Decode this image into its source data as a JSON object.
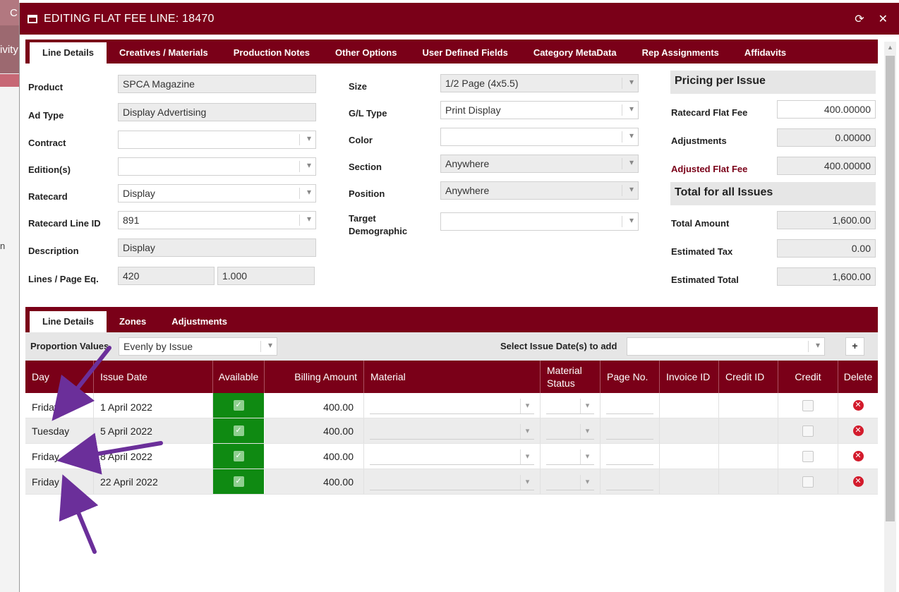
{
  "background": {
    "tab1": "C",
    "tab2": "ivity",
    "margin_char": "n"
  },
  "dialog": {
    "title": "EDITING FLAT FEE LINE: 18470",
    "refresh_icon": "refresh-icon",
    "close_icon": "close-icon",
    "accent_color": "#7a0018"
  },
  "tabs": [
    "Line Details",
    "Creatives / Materials",
    "Production Notes",
    "Other Options",
    "User Defined Fields",
    "Category MetaData",
    "Rep Assignments",
    "Affidavits"
  ],
  "form": {
    "product": {
      "label": "Product",
      "value": "SPCA Magazine"
    },
    "ad_type": {
      "label": "Ad Type",
      "value": "Display Advertising"
    },
    "contract": {
      "label": "Contract",
      "value": ""
    },
    "editions": {
      "label": "Edition(s)",
      "value": ""
    },
    "ratecard": {
      "label": "Ratecard",
      "value": "Display"
    },
    "ratecard_line_id": {
      "label": "Ratecard Line ID",
      "value": "891"
    },
    "description": {
      "label": "Description",
      "value": "Display"
    },
    "lines_page_eq": {
      "label": "Lines / Page Eq.",
      "lines": "420",
      "page_eq": "1.000"
    },
    "size": {
      "label": "Size",
      "value": "1/2 Page (4x5.5)"
    },
    "gl_type": {
      "label": "G/L Type",
      "value": "Print Display"
    },
    "color": {
      "label": "Color",
      "value": ""
    },
    "section": {
      "label": "Section",
      "value": "Anywhere"
    },
    "position": {
      "label": "Position",
      "value": "Anywhere"
    },
    "target_demographic": {
      "label_line1": "Target",
      "label_line2": "Demographic",
      "value": ""
    }
  },
  "pricing": {
    "header": "Pricing per Issue",
    "ratecard_flat_fee": {
      "label": "Ratecard Flat Fee",
      "value": "400.00000"
    },
    "adjustments": {
      "label": "Adjustments",
      "value": "0.00000"
    },
    "adjusted_flat_fee": {
      "label": "Adjusted Flat Fee",
      "value": "400.00000"
    },
    "total_header": "Total for all Issues",
    "total_amount": {
      "label": "Total Amount",
      "value": "1,600.00"
    },
    "estimated_tax": {
      "label": "Estimated Tax",
      "value": "0.00"
    },
    "estimated_total": {
      "label": "Estimated Total",
      "value": "1,600.00"
    }
  },
  "sub_tabs": [
    "Line Details",
    "Zones",
    "Adjustments"
  ],
  "toolbar": {
    "proportion_label": "Proportion Values",
    "proportion_value": "Evenly by Issue",
    "issue_date_label": "Select Issue Date(s) to add",
    "issue_date_value": "",
    "add_label": "+"
  },
  "table": {
    "headers": [
      "Day",
      "Issue Date",
      "Available",
      "Billing Amount",
      "Material",
      "Material Status",
      "Page No.",
      "Invoice ID",
      "Credit ID",
      "Credit",
      "Delete"
    ],
    "rows": [
      {
        "day": "Friday",
        "date": "1 April 2022",
        "amount": "400.00"
      },
      {
        "day": "Tuesday",
        "date": "5 April 2022",
        "amount": "400.00"
      },
      {
        "day": "Friday",
        "date": "8 April 2022",
        "amount": "400.00"
      },
      {
        "day": "Friday",
        "date": "22 April 2022",
        "amount": "400.00"
      }
    ]
  },
  "annotation_color": "#6b2f9a"
}
